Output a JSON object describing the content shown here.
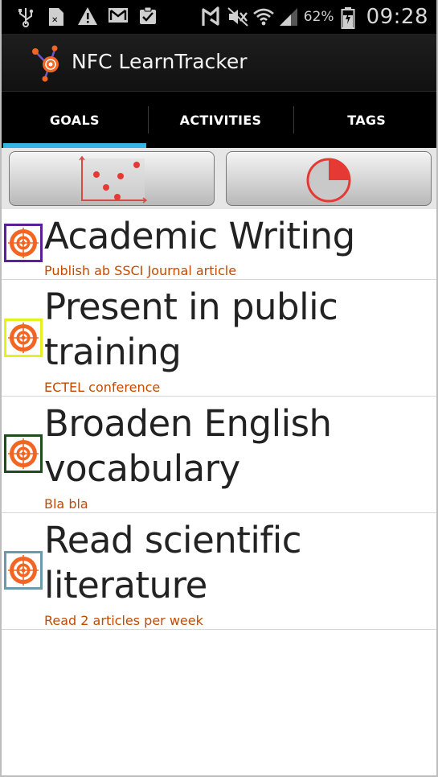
{
  "status_bar": {
    "left_icons": [
      "usb-icon",
      "sim-icon",
      "warning-icon",
      "gmail-icon",
      "clipboard-check-icon"
    ],
    "right_icons": [
      "nfc-icon",
      "mute-icon",
      "wifi-icon",
      "signal-icon",
      "battery-icon"
    ],
    "battery_percent": "62%",
    "time": "09:28"
  },
  "app": {
    "title": "NFC LearnTracker",
    "logo_icon": "nfc-learntracker-logo-icon"
  },
  "tabs": [
    {
      "label": "GOALS",
      "active": true
    },
    {
      "label": "ACTIVITIES",
      "active": false
    },
    {
      "label": "TAGS",
      "active": false
    }
  ],
  "toolbar": {
    "chart_button_icon": "scatter-chart-icon",
    "timer_button_icon": "pie-timer-icon"
  },
  "colors": {
    "accent": "#33b5e5",
    "description": "#c44a00",
    "target": "#f26522"
  },
  "goals": [
    {
      "title": "Academic Writing",
      "description": "Publish ab SSCI Journal article",
      "border_color": "#5b1f9a"
    },
    {
      "title": "Present in public training",
      "title_lines": [
        "Present in public",
        "training"
      ],
      "description": "ECTEL conference",
      "border_color": "#e6f01e"
    },
    {
      "title": "Broaden English vocabulary",
      "title_lines": [
        "Broaden English",
        "vocabulary"
      ],
      "description": "Bla bla",
      "border_color": "#1f4d1f"
    },
    {
      "title": "Read scientific literature",
      "title_lines": [
        "Read scientific",
        "literature"
      ],
      "description": "Read 2 articles per week",
      "border_color": "#6b9aa8"
    }
  ]
}
